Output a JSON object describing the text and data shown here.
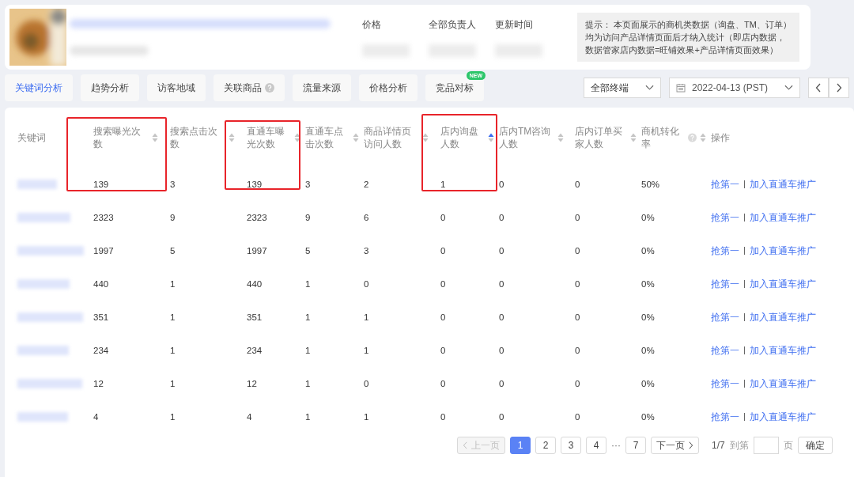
{
  "product": {
    "meta": [
      {
        "label": "价格"
      },
      {
        "label": "全部负责人"
      },
      {
        "label": "更新时间"
      }
    ],
    "tip_lines": [
      "提示： 本页面展示的商机类数据（询盘、TM、订单）",
      "均为访问产品详情页面后才纳入统计（即店内数据，",
      "数据管家店内数据=旺铺效果+产品详情页面效果）"
    ]
  },
  "tabs": [
    {
      "label": "关键词分析",
      "selected": true
    },
    {
      "label": "趋势分析",
      "selected": false
    },
    {
      "label": "访客地域",
      "selected": false
    },
    {
      "label": "关联商品",
      "selected": false,
      "help": true
    },
    {
      "label": "流量来源",
      "selected": false
    },
    {
      "label": "价格分析",
      "selected": false
    },
    {
      "label": "竞品对标",
      "selected": false,
      "badge": "NEW"
    }
  ],
  "terminal_select": {
    "value": "全部终端"
  },
  "date_picker": {
    "value": "2022-04-13 (PST)"
  },
  "table": {
    "columns": [
      {
        "label": "关键词"
      },
      {
        "label": "搜索曝光次数",
        "sorted": false,
        "highlighted": true
      },
      {
        "label": "搜索点击次数",
        "sorted": false
      },
      {
        "label": "直通车曝光次数",
        "sorted": false,
        "highlighted": true
      },
      {
        "label": "直通车点击次数",
        "sorted": false
      },
      {
        "label": "商品详情页访问人数",
        "sorted": false
      },
      {
        "label": "店内询盘人数",
        "sorted": true,
        "highlighted": true
      },
      {
        "label": "店内TM咨询人数",
        "sorted": false
      },
      {
        "label": "店内订单买家人数",
        "sorted": false
      },
      {
        "label": "商机转化率",
        "sorted": false,
        "help": true
      },
      {
        "label": "操作"
      }
    ],
    "rows": [
      {
        "values": [
          "139",
          "3",
          "139",
          "3",
          "2",
          "1",
          "0",
          "0",
          "50%"
        ],
        "actions": [
          "抢第一",
          "加入直通车推广"
        ]
      },
      {
        "values": [
          "2323",
          "9",
          "2323",
          "9",
          "6",
          "0",
          "0",
          "0",
          "0%"
        ],
        "actions": [
          "抢第一",
          "加入直通车推广"
        ]
      },
      {
        "values": [
          "1997",
          "5",
          "1997",
          "5",
          "3",
          "0",
          "0",
          "0",
          "0%"
        ],
        "actions": [
          "抢第一",
          "加入直通车推广"
        ]
      },
      {
        "values": [
          "440",
          "1",
          "440",
          "1",
          "0",
          "0",
          "0",
          "0",
          "0%"
        ],
        "actions": [
          "抢第一",
          "加入直通车推广"
        ]
      },
      {
        "values": [
          "351",
          "1",
          "351",
          "1",
          "1",
          "0",
          "0",
          "0",
          "0%"
        ],
        "actions": [
          "抢第一",
          "加入直通车推广"
        ]
      },
      {
        "values": [
          "234",
          "1",
          "234",
          "1",
          "1",
          "0",
          "0",
          "0",
          "0%"
        ],
        "actions": [
          "抢第一",
          "加入直通车推广"
        ]
      },
      {
        "values": [
          "12",
          "1",
          "12",
          "1",
          "0",
          "0",
          "0",
          "0",
          "0%"
        ],
        "actions": [
          "抢第一",
          "加入直通车推广"
        ]
      },
      {
        "values": [
          "4",
          "1",
          "4",
          "1",
          "1",
          "0",
          "0",
          "0",
          "0%"
        ],
        "actions": [
          "抢第一",
          "加入直通车推广"
        ]
      }
    ]
  },
  "pagination": {
    "prev": "上一页",
    "next": "下一页",
    "pages": [
      {
        "label": "1",
        "selected": true
      },
      {
        "label": "2",
        "selected": false
      },
      {
        "label": "3",
        "selected": false
      },
      {
        "label": "4",
        "selected": false
      },
      {
        "label": "···",
        "kind": "ellipsis"
      },
      {
        "label": "7",
        "selected": false
      }
    ],
    "prev_disabled": true,
    "page_count": "1/7",
    "goto_label": "到第",
    "page_unit": "页",
    "confirm": "确定"
  }
}
